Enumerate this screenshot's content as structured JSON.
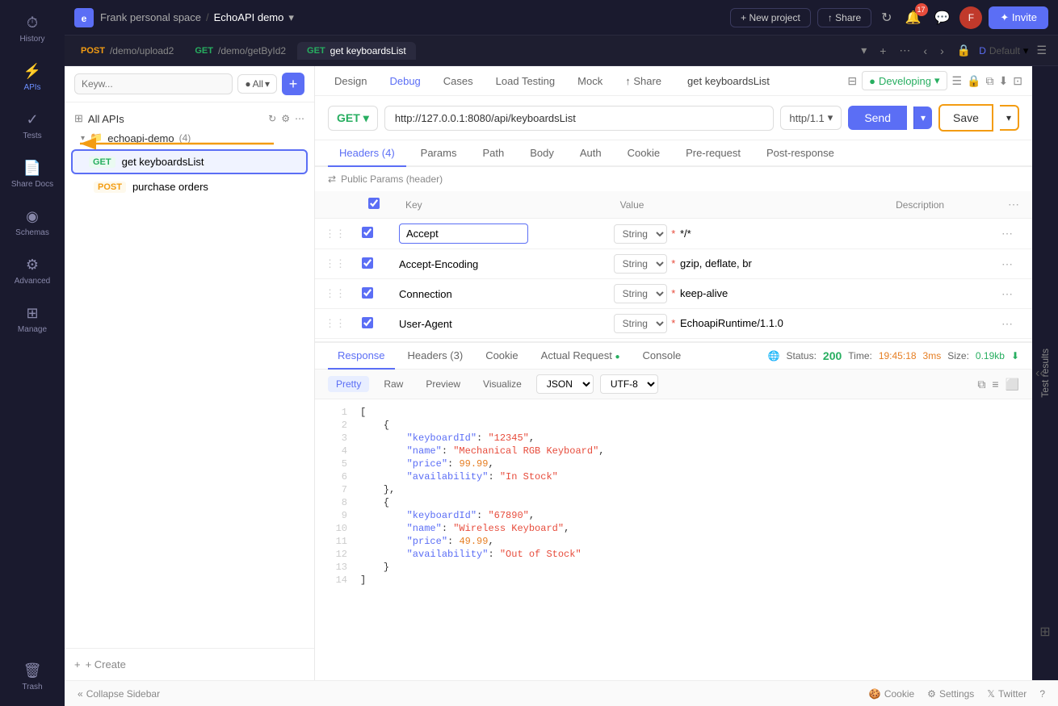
{
  "app": {
    "title": "EchoAPI demo",
    "workspace": "Frank personal space",
    "chevron": "▾"
  },
  "topbar": {
    "new_project_label": "+ New project",
    "share_label": "↑ Share",
    "invite_label": "✦ Invite",
    "notif_count": "17"
  },
  "sidebar": {
    "items": [
      {
        "id": "history",
        "label": "History",
        "icon": "⏱"
      },
      {
        "id": "apis",
        "label": "APIs",
        "icon": "⚡"
      },
      {
        "id": "tests",
        "label": "Tests",
        "icon": "✓"
      },
      {
        "id": "share-docs",
        "label": "Share Docs",
        "icon": "📄"
      },
      {
        "id": "schemas",
        "label": "Schemas",
        "icon": "◉"
      },
      {
        "id": "advanced",
        "label": "Advanced",
        "icon": "⚙"
      },
      {
        "id": "manage",
        "label": "Manage",
        "icon": "⊞"
      }
    ],
    "bottom": {
      "id": "trash",
      "label": "Trash",
      "icon": "🗑"
    }
  },
  "tabs": [
    {
      "id": "tab1",
      "method": "POST",
      "path": "/demo/upload2"
    },
    {
      "id": "tab2",
      "method": "GET",
      "path": "/demo/getById2"
    },
    {
      "id": "tab3",
      "method": "GET",
      "path": "get keyboardsList",
      "active": true
    }
  ],
  "api_tabs": {
    "items": [
      "Design",
      "Debug",
      "Cases",
      "Load Testing",
      "Mock",
      "Share"
    ],
    "active": "Debug",
    "api_name": "get keyboardsList"
  },
  "url_bar": {
    "method": "GET",
    "url": "http://127.0.0.1:8080/api/keyboardsList",
    "http_version": "http/1.1",
    "send_label": "Send",
    "save_label": "Save"
  },
  "params_tabs": {
    "items": [
      {
        "id": "headers",
        "label": "Headers",
        "count": "(4)"
      },
      {
        "id": "params",
        "label": "Params"
      },
      {
        "id": "path",
        "label": "Path"
      },
      {
        "id": "body",
        "label": "Body"
      },
      {
        "id": "auth",
        "label": "Auth"
      },
      {
        "id": "cookie",
        "label": "Cookie"
      },
      {
        "id": "pre-request",
        "label": "Pre-request"
      },
      {
        "id": "post-response",
        "label": "Post-response"
      }
    ],
    "active": "headers"
  },
  "headers": {
    "public_params_label": "Public Params (header)",
    "columns": [
      "Key",
      "Value",
      "Description"
    ],
    "rows": [
      {
        "key": "Accept",
        "type": "String",
        "required": true,
        "value": "*/*"
      },
      {
        "key": "Accept-Encoding",
        "type": "String",
        "required": true,
        "value": "gzip, deflate, br"
      },
      {
        "key": "Connection",
        "type": "String",
        "required": true,
        "value": "keep-alive"
      },
      {
        "key": "User-Agent",
        "type": "String",
        "required": true,
        "value": "EchoapiRuntime/1.1.0"
      }
    ]
  },
  "response": {
    "tabs": [
      "Response",
      "Headers (3)",
      "Cookie",
      "Actual Request",
      "Console"
    ],
    "active_tab": "Response",
    "status": "200",
    "time_label": "Time:",
    "time_value": "19:45:18",
    "duration": "3ms",
    "size_label": "Size:",
    "size_value": "0.19kb",
    "view_modes": [
      "Pretty",
      "Raw",
      "Preview",
      "Visualize"
    ],
    "active_view": "Pretty",
    "format": "JSON",
    "encoding": "UTF-8",
    "code_lines": [
      {
        "num": 1,
        "text": "["
      },
      {
        "num": 2,
        "text": "    {"
      },
      {
        "num": 3,
        "text": "        \"keyboardId\": \"12345\","
      },
      {
        "num": 4,
        "text": "        \"name\": \"Mechanical RGB Keyboard\","
      },
      {
        "num": 5,
        "text": "        \"price\": 99.99,"
      },
      {
        "num": 6,
        "text": "        \"availability\": \"In Stock\""
      },
      {
        "num": 7,
        "text": "    },"
      },
      {
        "num": 8,
        "text": "    {"
      },
      {
        "num": 9,
        "text": "        \"keyboardId\": \"67890\","
      },
      {
        "num": 10,
        "text": "        \"name\": \"Wireless Keyboard\","
      },
      {
        "num": 11,
        "text": "        \"price\": 49.99,"
      },
      {
        "num": 12,
        "text": "        \"availability\": \"Out of Stock\""
      },
      {
        "num": 13,
        "text": "    }"
      },
      {
        "num": 14,
        "text": "]"
      }
    ]
  },
  "bottom_bar": {
    "collapse_label": "Collapse Sidebar",
    "cookie_label": "Cookie",
    "settings_label": "Settings",
    "twitter_label": "Twitter"
  },
  "left_panel": {
    "search_placeholder": "Keyw...",
    "all_apis_label": "All APIs",
    "group_name": "echoapi-demo",
    "group_count": "(4)",
    "active_item": "get keyboardsList",
    "active_method": "GET",
    "sub_item": "purchase orders",
    "sub_method": "POST",
    "create_label": "+ Create",
    "env_label": "Developing"
  },
  "colors": {
    "accent": "#5b6ef5",
    "get": "#27ae60",
    "post": "#f39c12",
    "danger": "#e74c3c",
    "border_highlight": "#f39c12"
  }
}
